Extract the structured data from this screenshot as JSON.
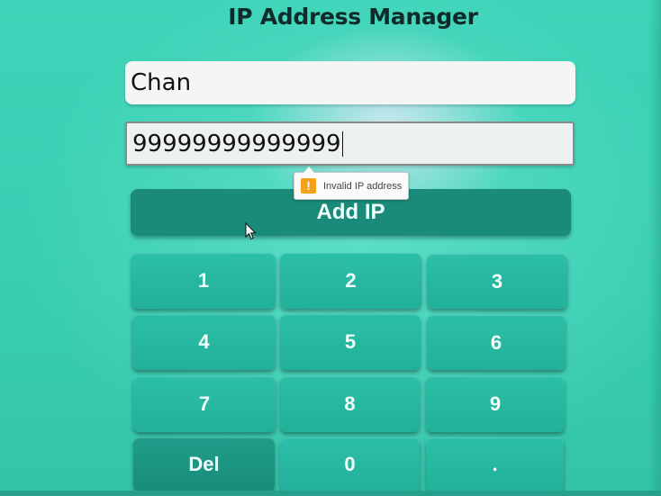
{
  "app": {
    "title": "IP Address Manager"
  },
  "form": {
    "name_value": "Chan",
    "ip_value": "99999999999999",
    "validation_message": "Invalid IP address",
    "warning_symbol": "!",
    "add_button_label": "Add IP"
  },
  "keypad": {
    "keys": [
      "1",
      "2",
      "3",
      "4",
      "5",
      "6",
      "7",
      "8",
      "9",
      "Del",
      "0",
      "."
    ]
  },
  "colors": {
    "background": "#3fd4b9",
    "button": "#1a8a7a",
    "key": "#22b09a",
    "warning": "#f2a21b"
  },
  "icons": {
    "warning": "warning-icon",
    "cursor": "mouse-pointer-icon"
  }
}
